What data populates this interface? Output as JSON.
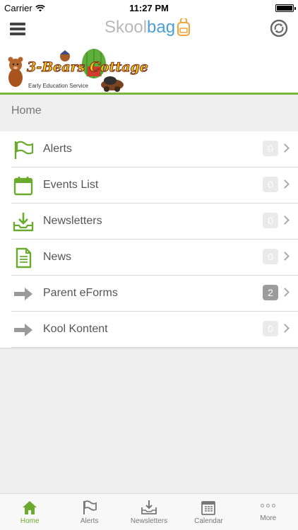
{
  "status_bar": {
    "carrier": "Carrier",
    "time": "11:27 PM",
    "battery_level": 1.0
  },
  "nav_bar": {
    "title_part1": "Skool",
    "title_part2": "bag",
    "menu_icon": "hamburger-icon",
    "sync_icon": "sync-icon"
  },
  "banner": {
    "logo_text": "3-Bears Cottage",
    "logo_subtitle": "Early Education Service"
  },
  "section_header": "Home",
  "menu_items": [
    {
      "label": "Alerts",
      "badge": "0",
      "icon": "flag-icon"
    },
    {
      "label": "Events List",
      "badge": "0",
      "icon": "calendar-icon"
    },
    {
      "label": "Newsletters",
      "badge": "0",
      "icon": "inbox-download-icon"
    },
    {
      "label": "News",
      "badge": "0",
      "icon": "document-icon"
    },
    {
      "label": "Parent eForms",
      "badge": "2",
      "icon": "arrow-right-icon"
    },
    {
      "label": "Kool Kontent",
      "badge": "0",
      "icon": "arrow-right-icon"
    }
  ],
  "tabs": [
    {
      "label": "Home",
      "icon": "home-icon",
      "active": true
    },
    {
      "label": "Alerts",
      "icon": "flag-icon"
    },
    {
      "label": "Newsletters",
      "icon": "inbox-download-icon"
    },
    {
      "label": "Calendar",
      "icon": "calendar-icon"
    },
    {
      "label": "More",
      "icon": "more-dots-icon"
    }
  ],
  "colors": {
    "accent_green": "#6aab2e",
    "title_blue": "#4aa0d6",
    "title_grey": "#b8b8b8",
    "badge_active": "#9c9c9c"
  }
}
